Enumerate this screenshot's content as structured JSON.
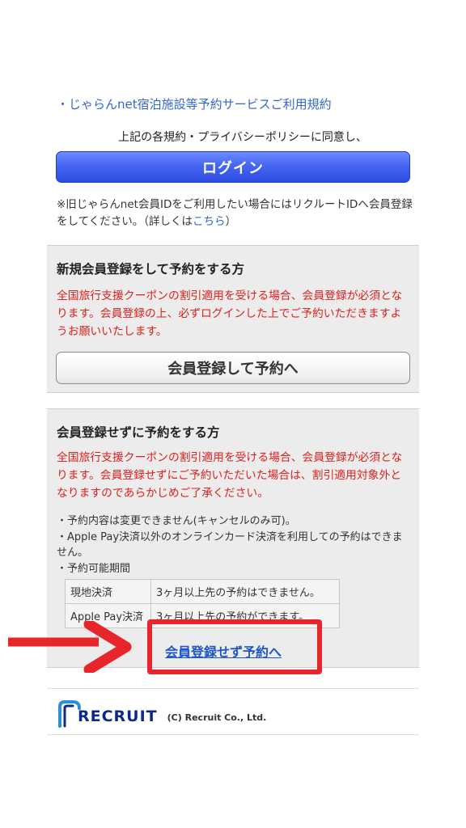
{
  "terms": {
    "bullet": "・",
    "link_label": "じゃらんnet宿泊施設等予約サービスご利用規約"
  },
  "agree_text": "上記の各規約・プライバシーポリシーに同意し、",
  "login_button": "ログイン",
  "old_id_note": {
    "text": "※旧じゃらんnet会員IDをご利用したい場合にはリクルートIDへ会員登録をしてください。（詳しくは",
    "link": "こちら",
    "suffix": "）"
  },
  "member_section": {
    "title": "新規会員登録をして予約をする方",
    "warning": "全国旅行支援クーポンの割引適用を受ける場合、会員登録が必須となります。会員登録の上、必ずログインした上でご予約いただきますようお願いいたします。",
    "button": "会員登録して予約へ"
  },
  "guest_section": {
    "title": "会員登録せずに予約をする方",
    "warning": "全国旅行支援クーポンの割引適用を受ける場合、会員登録が必須となります。会員登録せずにご予約いただいた場合は、割引適用対象外となりますのであらかじめご了承ください。",
    "notes": [
      "・予約内容は変更できません(キャンセルのみ可)。",
      "・Apple Pay決済以外のオンラインカード決済を利用しての予約はできません。",
      "・予約可能期間"
    ],
    "period_table": [
      {
        "method": "現地決済",
        "rule": "3ヶ月以上先の予約はできません。"
      },
      {
        "method": "Apple Pay決済",
        "rule": "3ヶ月以上先の予約ができます。"
      }
    ],
    "link": "会員登録せず予約へ"
  },
  "annotation": {
    "highlight_color": "#e8252a",
    "arrow_icon": "right-arrow-icon"
  },
  "footer": {
    "logo_text": "RECRUIT",
    "copyright": "(C) Recruit Co., Ltd."
  },
  "colors": {
    "link": "#3366cc",
    "warning": "#e0201c",
    "login_button": "#4565f2",
    "logo": "#0d2a8a"
  }
}
